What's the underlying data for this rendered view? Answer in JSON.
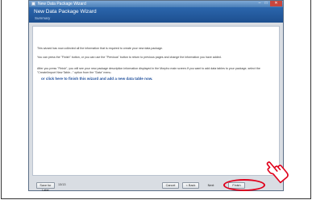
{
  "window": {
    "title": "New Data Package Wizard",
    "controls": {
      "minimize": "–",
      "maximize": "□",
      "close": "✕"
    }
  },
  "header": {
    "title": "New Data Package Wizard",
    "subtitle": "Summary"
  },
  "content": {
    "paragraph1": "This wizard has now collected all the information that is required to create your new data package.",
    "paragraph2": "You can press the \"Finish\" button, or you can use the \"Previous\" button to return to previous pages and change the information you have added.",
    "paragraph3": "After you press \"Finish\", you will see your new package description information displayed in the Morpho main screen.If you want to add data tables to your package, select the \"Create/Import New Table...\" option from the \"Data\" menu.",
    "link": "or click here to finish this wizard and add a new data table now."
  },
  "footer": {
    "save_label": "Save for Later",
    "page_indicator": "13/13",
    "cancel_label": "Cancel",
    "back_label": "< Back",
    "next_label": "Next",
    "finish_label": "Finish"
  },
  "icons": {
    "cursor": "hand-pointer-icon",
    "highlight": "red-ellipse"
  },
  "colors": {
    "header_blue": "#1d4f8f",
    "link_blue": "#1f4f9c",
    "highlight_red": "#e0001b"
  }
}
